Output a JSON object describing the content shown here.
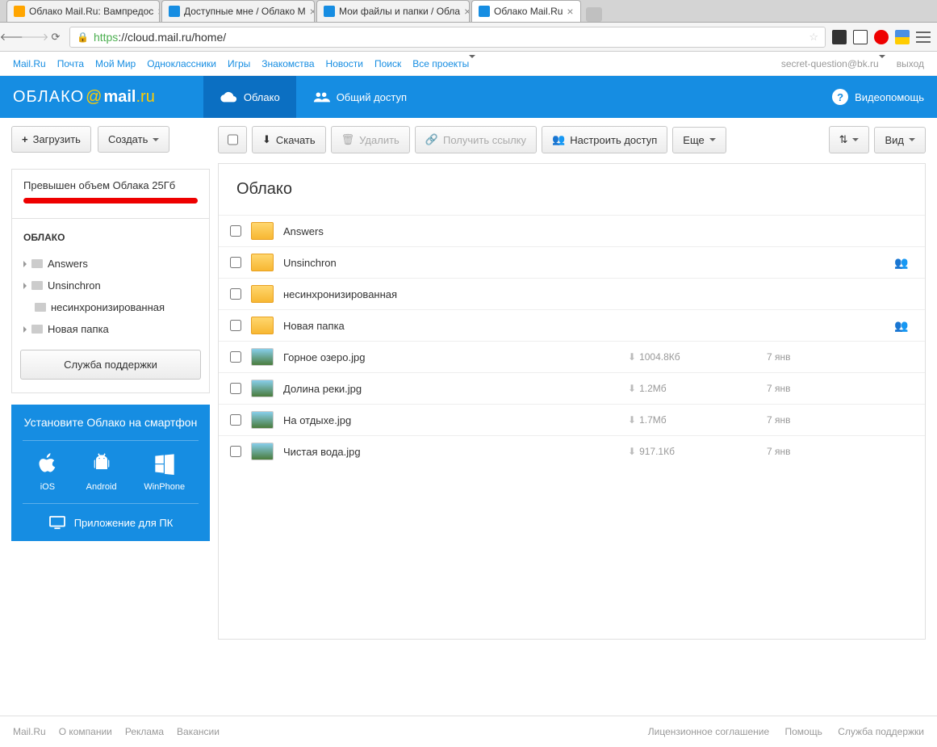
{
  "browser": {
    "tabs": [
      {
        "title": "Облако Mail.Ru: Вампредос",
        "active": false
      },
      {
        "title": "Доступные мне / Облако M",
        "active": false
      },
      {
        "title": "Мои файлы и папки / Обла",
        "active": false
      },
      {
        "title": "Облако Mail.Ru",
        "active": true
      }
    ],
    "url_https": "https",
    "url_rest": "://cloud.mail.ru/home/"
  },
  "topnav": {
    "links": [
      "Mail.Ru",
      "Почта",
      "Мой Мир",
      "Одноклассники",
      "Игры",
      "Знакомства",
      "Новости",
      "Поиск",
      "Все проекты"
    ],
    "email": "secret-question@bk.ru",
    "logout": "выход"
  },
  "header": {
    "logo_oblako": "ОБЛАКО",
    "logo_mail": "mail",
    "logo_ru": ".ru",
    "tab_cloud": "Облако",
    "tab_shared": "Общий доступ",
    "help": "Видеопомощь"
  },
  "sidebar": {
    "upload": "Загрузить",
    "create": "Создать",
    "quota_text": "Превышен объем Облака 25Гб",
    "tree_title": "ОБЛАКО",
    "folders": [
      {
        "name": "Answers",
        "expandable": true
      },
      {
        "name": "Unsinchron",
        "expandable": true
      },
      {
        "name": "несинхронизированная",
        "expandable": false
      },
      {
        "name": "Новая папка",
        "expandable": true
      }
    ],
    "support": "Служба поддержки",
    "promo_title": "Установите Облако на смартфон",
    "promo_ios": "iOS",
    "promo_android": "Android",
    "promo_win": "WinPhone",
    "promo_desktop": "Приложение для ПК"
  },
  "toolbar": {
    "download": "Скачать",
    "delete": "Удалить",
    "link": "Получить ссылку",
    "access": "Настроить доступ",
    "more": "Еще",
    "view": "Вид"
  },
  "content": {
    "title": "Облако",
    "files": [
      {
        "type": "folder",
        "name": "Answers",
        "size": "",
        "date": "",
        "shared": false
      },
      {
        "type": "folder-shared",
        "name": "Unsinchron",
        "size": "",
        "date": "",
        "shared": true
      },
      {
        "type": "folder",
        "name": "несинхронизированная",
        "size": "",
        "date": "",
        "shared": false
      },
      {
        "type": "folder-shared",
        "name": "Новая папка",
        "size": "",
        "date": "",
        "shared": true
      },
      {
        "type": "image",
        "name": "Горное озеро.jpg",
        "size": "1004.8Кб",
        "date": "7 янв",
        "shared": false
      },
      {
        "type": "image",
        "name": "Долина реки.jpg",
        "size": "1.2Мб",
        "date": "7 янв",
        "shared": false
      },
      {
        "type": "image",
        "name": "На отдыхе.jpg",
        "size": "1.7Мб",
        "date": "7 янв",
        "shared": false
      },
      {
        "type": "image",
        "name": "Чистая вода.jpg",
        "size": "917.1Кб",
        "date": "7 янв",
        "shared": false
      }
    ]
  },
  "footer": {
    "left": [
      "Mail.Ru",
      "О компании",
      "Реклама",
      "Вакансии"
    ],
    "right": [
      "Лицензионное соглашение",
      "Помощь",
      "Служба поддержки"
    ]
  }
}
